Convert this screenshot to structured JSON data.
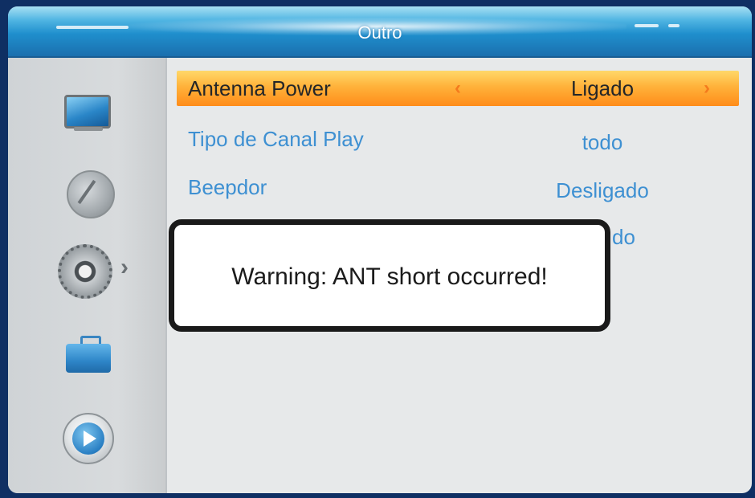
{
  "window": {
    "title": "Outro"
  },
  "sidebar": {
    "icons": [
      "tv-icon",
      "satellite-dish-icon",
      "gear-icon",
      "toolbox-icon",
      "play-icon"
    ],
    "selected_index": 2
  },
  "settings": [
    {
      "label": "Antenna Power",
      "value": "Ligado",
      "selected": true
    },
    {
      "label": "Tipo de Canal Play",
      "value": "todo",
      "selected": false
    },
    {
      "label": "Beepdor",
      "value": "Desligado",
      "selected": false
    }
  ],
  "obscured_row": {
    "visible_value_fragment": "do"
  },
  "dialog": {
    "message": "Warning: ANT short occurred!"
  },
  "colors": {
    "title_bar": "#1f8fcd",
    "selection": "#ffb23a",
    "text_blue": "#3e90d2",
    "arrow_orange": "#f47a1d"
  }
}
